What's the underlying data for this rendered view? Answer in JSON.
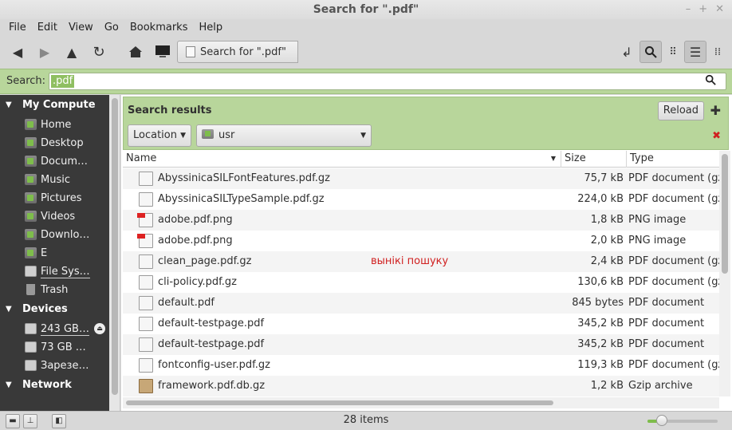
{
  "window": {
    "title": "Search for \".pdf\"",
    "controls": [
      "–",
      "+",
      "✕"
    ]
  },
  "menu": [
    "File",
    "Edit",
    "View",
    "Go",
    "Bookmarks",
    "Help"
  ],
  "toolbar": {
    "location_crumb": "Search for \".pdf\""
  },
  "search": {
    "label": "Search:",
    "value": ".pdf"
  },
  "sidebar": {
    "my_computer": {
      "heading": "My Compute",
      "items": [
        "Home",
        "Desktop",
        "Docum…",
        "Music",
        "Pictures",
        "Videos",
        "Downlo…",
        "E",
        "File Sys…",
        "Trash"
      ]
    },
    "devices": {
      "heading": "Devices",
      "items": [
        "243 GB…",
        "73 GB …",
        "Зарезе…"
      ]
    },
    "network": {
      "heading": "Network"
    }
  },
  "results": {
    "heading": "Search results",
    "reload_label": "Reload",
    "location_filter": "Location",
    "folder_filter": "usr"
  },
  "columns": {
    "name": "Name",
    "size": "Size",
    "type": "Type"
  },
  "files": [
    {
      "name": "AbyssinicaSILFontFeatures.pdf.gz",
      "size": "75,7 kB",
      "type": "PDF document (gz",
      "icon": "doc-archive-icon"
    },
    {
      "name": "AbyssinicaSILTypeSample.pdf.gz",
      "size": "224,0 kB",
      "type": "PDF document (gz",
      "icon": "doc-archive-icon"
    },
    {
      "name": "adobe.pdf.png",
      "size": "1,8 kB",
      "type": "PNG image",
      "icon": "pdf-image-icon"
    },
    {
      "name": "adobe.pdf.png",
      "size": "2,0 kB",
      "type": "PNG image",
      "icon": "pdf-image-icon"
    },
    {
      "name": "clean_page.pdf.gz",
      "size": "2,4 kB",
      "type": "PDF document (gz",
      "icon": "doc-archive-icon"
    },
    {
      "name": "cli-policy.pdf.gz",
      "size": "130,6 kB",
      "type": "PDF document (gz",
      "icon": "doc-archive-icon"
    },
    {
      "name": "default.pdf",
      "size": "845 bytes",
      "type": "PDF document",
      "icon": "doc-icon"
    },
    {
      "name": "default-testpage.pdf",
      "size": "345,2 kB",
      "type": "PDF document",
      "icon": "doc-icon"
    },
    {
      "name": "default-testpage.pdf",
      "size": "345,2 kB",
      "type": "PDF document",
      "icon": "doc-icon"
    },
    {
      "name": "fontconfig-user.pdf.gz",
      "size": "119,3 kB",
      "type": "PDF document (gz",
      "icon": "doc-archive-icon"
    },
    {
      "name": "framework.pdf.db.gz",
      "size": "1,2 kB",
      "type": "Gzip archive",
      "icon": "archive-icon"
    }
  ],
  "annotation": "вынікі пошуку",
  "status": {
    "count": "28 items",
    "zoom_fraction": 0.2
  },
  "colors": {
    "accent_green": "#b8d69b",
    "note_red": "#d02020",
    "sidebar_bg": "#393939"
  }
}
